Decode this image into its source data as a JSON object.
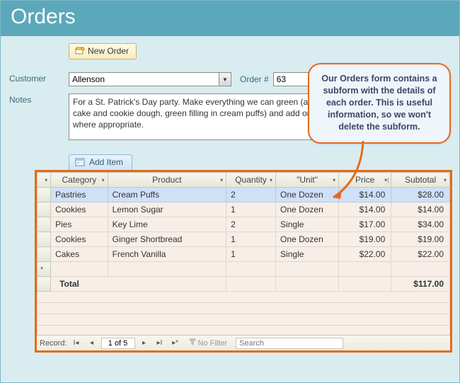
{
  "title": "Orders",
  "newOrderLabel": "New Order",
  "customerLabel": "Customer",
  "customerValue": "Allenson",
  "orderNumLabel": "Order #",
  "orderNumValue": "63",
  "notesLabel": "Notes",
  "notesValue": "For a St. Patrick's Day party. Make everything we can green (add food coloring to cake and cookie dough, green filling in cream puffs) and add on green sprinkles where appropriate.",
  "addItemLabel": "Add Item",
  "cols": {
    "category": "Category",
    "product": "Product",
    "quantity": "Quantity",
    "unit": "\"Unit\"",
    "price": "Price",
    "subtotal": "Subtotal"
  },
  "rows": [
    {
      "category": "Pastries",
      "product": "Cream Puffs",
      "quantity": "2",
      "unit": "One Dozen",
      "price": "$14.00",
      "subtotal": "$28.00"
    },
    {
      "category": "Cookies",
      "product": "Lemon Sugar",
      "quantity": "1",
      "unit": "One Dozen",
      "price": "$14.00",
      "subtotal": "$14.00"
    },
    {
      "category": "Pies",
      "product": "Key Lime",
      "quantity": "2",
      "unit": "Single",
      "price": "$17.00",
      "subtotal": "$34.00"
    },
    {
      "category": "Cookies",
      "product": "Ginger Shortbread",
      "quantity": "1",
      "unit": "One Dozen",
      "price": "$19.00",
      "subtotal": "$19.00"
    },
    {
      "category": "Cakes",
      "product": "French Vanilla",
      "quantity": "1",
      "unit": "Single",
      "price": "$22.00",
      "subtotal": "$22.00"
    }
  ],
  "totalLabel": "Total",
  "totalValue": "$117.00",
  "recordNav": {
    "label": "Record:",
    "pos": "1 of 5",
    "noFilter": "No Filter",
    "search": "Search"
  },
  "callout": "Our Orders form contains a subform with the details of each order. This is useful information, so we won't delete the subform.",
  "colors": {
    "accent": "#e56a1a",
    "titlebar": "#5ba8ba"
  }
}
